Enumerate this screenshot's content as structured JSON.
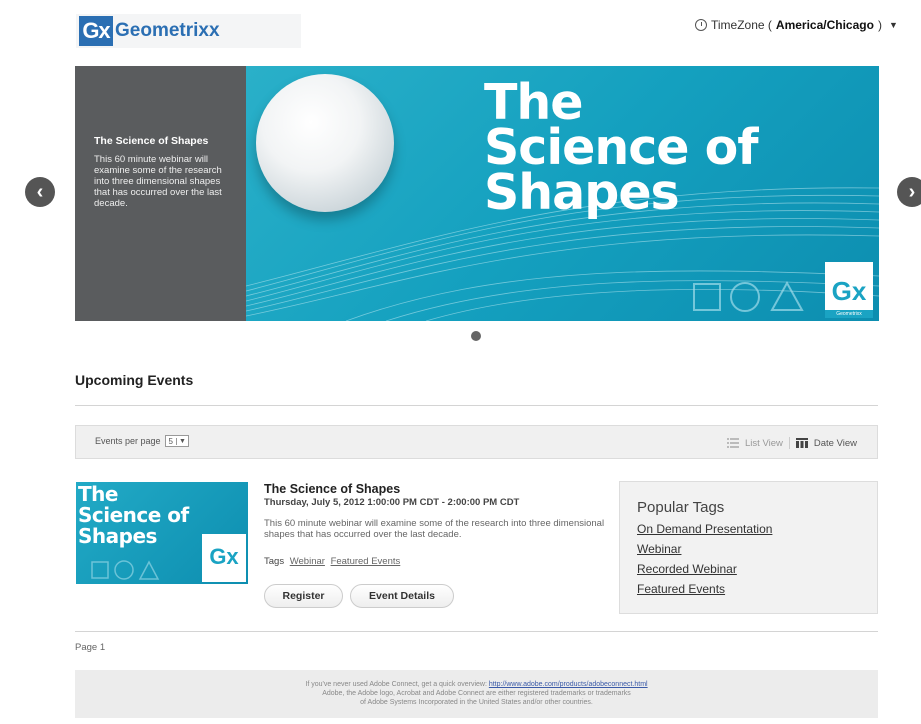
{
  "header": {
    "logo_mark": "Gx",
    "logo_text": "Geometrixx",
    "timezone_prefix": "TimeZone (",
    "timezone_value": "America/Chicago",
    "timezone_suffix": ")"
  },
  "carousel": {
    "slide_title": "The Science of Shapes",
    "slide_desc": "This 60 minute webinar will examine some of the research into three dimensional shapes that has occurred over the last decade.",
    "banner_line1": "The",
    "banner_line2": "Science of",
    "banner_line3": "Shapes",
    "banner_logo": "Gx",
    "banner_logo_sub": "Geometrixx"
  },
  "section": {
    "title": "Upcoming Events"
  },
  "toolbar": {
    "events_per_page_label": "Events per page",
    "events_per_page_value": "5",
    "list_view": "List View",
    "date_view": "Date View"
  },
  "event": {
    "thumb_line1": "The",
    "thumb_line2": "Science of",
    "thumb_line3": "Shapes",
    "thumb_logo": "Gx",
    "title": "The Science of Shapes",
    "date": "Thursday, July 5, 2012 1:00:00 PM CDT - 2:00:00 PM CDT",
    "description": "This 60 minute webinar will examine some of the research into three dimensional shapes that has occurred over the last decade.",
    "tags_label": "Tags",
    "tags": [
      "Webinar",
      "Featured Events"
    ],
    "register_label": "Register",
    "details_label": "Event Details"
  },
  "popular_tags": {
    "title": "Popular Tags",
    "items": [
      "On Demand Presentation",
      "Webinar",
      "Recorded Webinar",
      "Featured Events"
    ]
  },
  "pagination": {
    "label": "Page 1"
  },
  "footer": {
    "line1_text": "If you've never used Adobe Connect, get a quick overview: ",
    "line1_link": "http://www.adobe.com/products/adobeconnect.html",
    "line2": "Adobe, the Adobe logo, Acrobat and Adobe Connect are either registered trademarks or trademarks",
    "line3": "of Adobe Systems Incorporated in the United States and/or other countries."
  },
  "colors": {
    "brand_blue": "#2b6fb3",
    "banner_teal": "#14a0bf",
    "slide_panel": "#5a5c5e"
  }
}
